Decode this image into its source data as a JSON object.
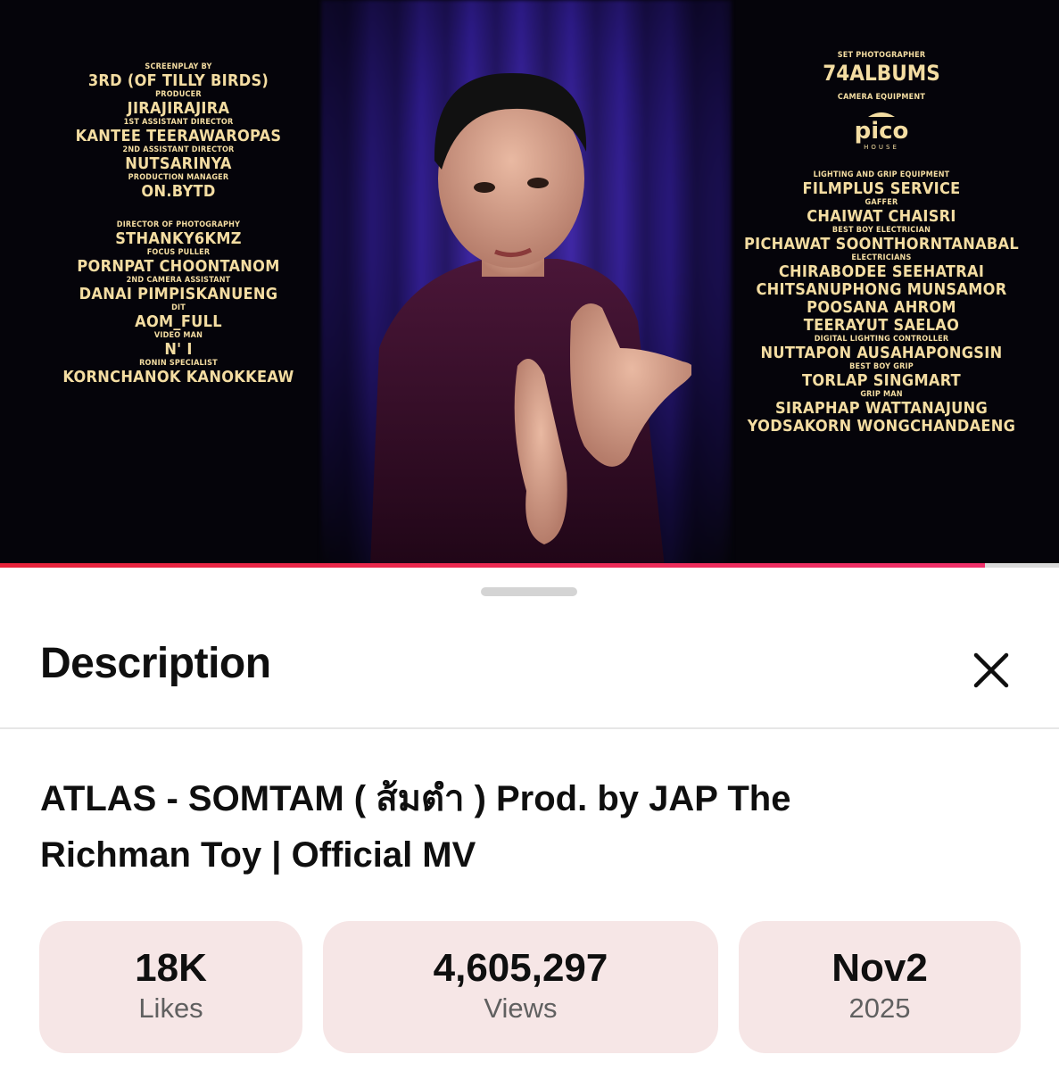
{
  "video": {
    "progress_fraction": 0.93,
    "credits_left": [
      {
        "role": "SCREENPLAY BY",
        "name": "3RD (OF TILLY BIRDS)"
      },
      {
        "role": "PRODUCER",
        "name": "JIRAJIRAJIRA"
      },
      {
        "role": "1ST ASSISTANT DIRECTOR",
        "name": "KANTEE TEERAWAROPAS"
      },
      {
        "role": "2ND ASSISTANT DIRECTOR",
        "name": "NUTSARINYA"
      },
      {
        "role": "PRODUCTION MANAGER",
        "name": "ON.BYTD"
      },
      {
        "role": "DIRECTOR OF PHOTOGRAPHY",
        "name": "STHANKY6KMZ"
      },
      {
        "role": "FOCUS PULLER",
        "name": "PORNPAT CHOONTANOM"
      },
      {
        "role": "2ND CAMERA ASSISTANT",
        "name": "DANAI PIMPISKANUENG"
      },
      {
        "role": "DIT",
        "name": "AOM_FULL"
      },
      {
        "role": "VIDEO MAN",
        "name": "N' I"
      },
      {
        "role": "RONIN SPECIALIST",
        "name": "KORNCHANOK KANOKKEAW"
      }
    ],
    "credits_right": {
      "set_photographer_role": "SET PHOTOGRAPHER",
      "set_photographer_name": "74ALBUMS",
      "camera_equipment_role": "CAMERA EQUIPMENT",
      "logo_text": "pico",
      "logo_subtext": "HOUSE",
      "lighting_role": "LIGHTING AND GRIP EQUIPMENT",
      "lighting_name": "FILMPLUS SERVICE",
      "gaffer_role": "GAFFER",
      "gaffer_name": "CHAIWAT CHAISRI",
      "best_boy_electrician_role": "BEST BOY ELECTRICIAN",
      "best_boy_electrician_name": "PICHAWAT SOONTHORNTANABAL",
      "electricians_role": "ELECTRICIANS",
      "electricians": [
        "CHIRABODEE SEEHATRAI",
        "CHITSANUPHONG MUNSAMOR",
        "POOSANA AHROM",
        "TEERAYUT SAELAO"
      ],
      "lighting_controller_role": "DIGITAL LIGHTING CONTROLLER",
      "lighting_controller_name": "NUTTAPON AUSAHAPONGSIN",
      "best_boy_grip_role": "BEST BOY GRIP",
      "best_boy_grip_name": "TORLAP SINGMART",
      "grip_man_role": "GRIP MAN",
      "grip_men": [
        "SIRAPHAP WATTANAJUNG",
        "YODSAKORN WONGCHANDAENG"
      ]
    }
  },
  "sheet": {
    "header_title": "Description",
    "close_icon": "close-icon",
    "video_title": "ATLAS - SOMTAM ( ส้มตำ ) Prod. by JAP The Richman Toy | Official MV",
    "stats": {
      "likes_value": "18K",
      "likes_label": "Likes",
      "views_value": "4,605,297",
      "views_label": "Views",
      "date_value": "Nov2",
      "date_label": "2025"
    },
    "colors": {
      "stat_bg": "#f6e6e6",
      "progress_red": "#e8233a",
      "credit_gold": "#f4dda2"
    }
  }
}
